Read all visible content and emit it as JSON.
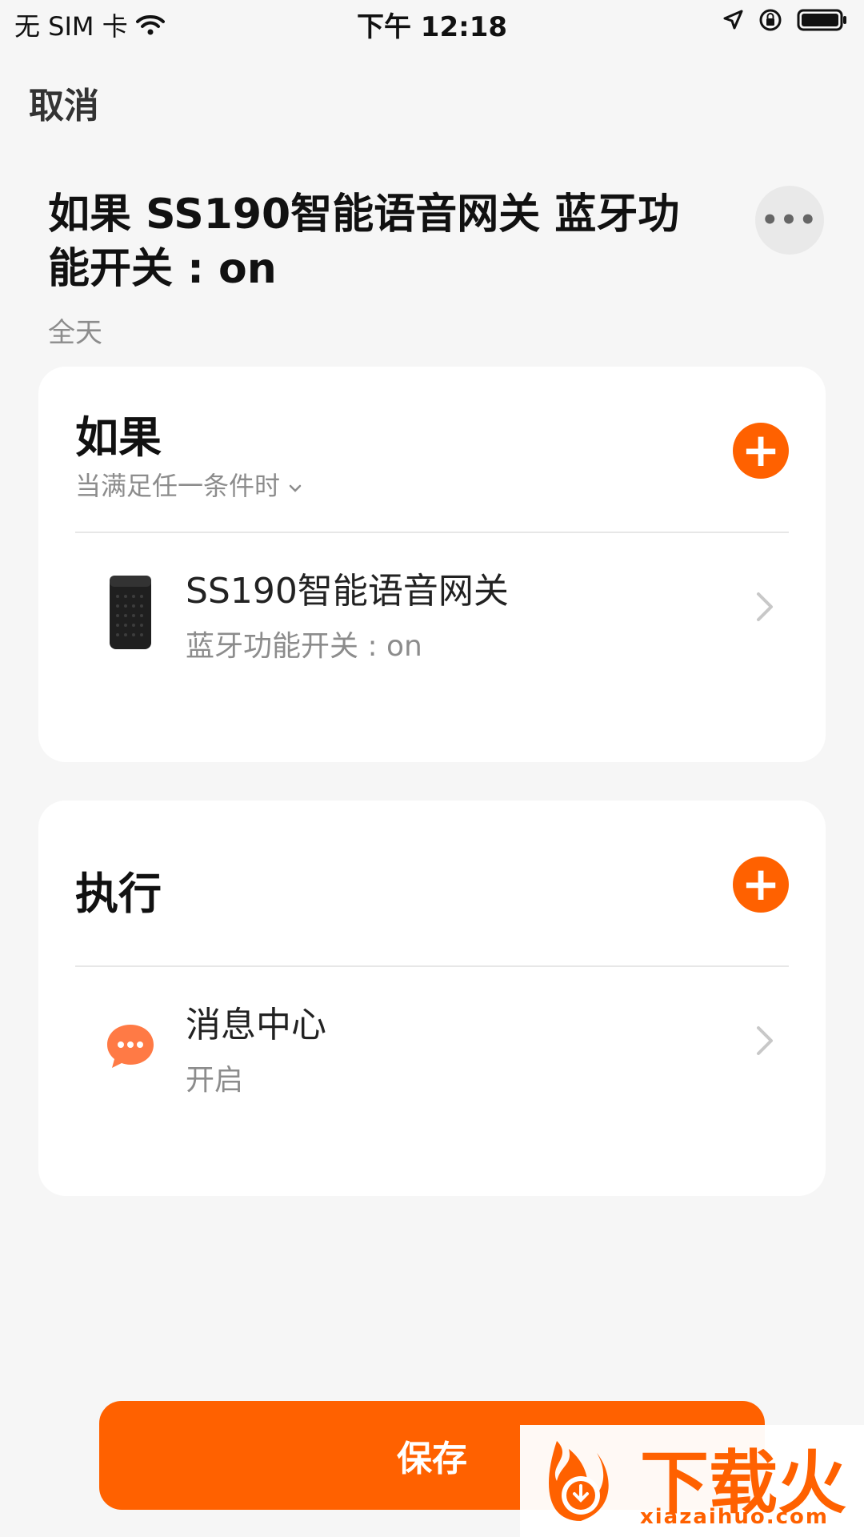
{
  "status_bar": {
    "carrier": "无 SIM 卡",
    "time": "下午 12:18"
  },
  "header": {
    "cancel_label": "取消",
    "title": "如果 SS190智能语音网关 蓝牙功能开关 : on",
    "more_label": "•••",
    "schedule": "全天"
  },
  "if_card": {
    "title": "如果",
    "condition_mode": "当满足任一条件时",
    "add_label": "+",
    "item": {
      "title": "SS190智能语音网关",
      "subtitle": "蓝牙功能开关 : on"
    }
  },
  "then_card": {
    "title": "执行",
    "add_label": "+",
    "item": {
      "title": "消息中心",
      "subtitle": "开启"
    }
  },
  "footer": {
    "save_label": "保存"
  },
  "watermark": {
    "brand": "下载火",
    "url": "xiazaihuo.com"
  },
  "colors": {
    "accent": "#ff6100",
    "background": "#f6f6f6",
    "card": "#ffffff",
    "message_icon": "#ff7a45"
  }
}
